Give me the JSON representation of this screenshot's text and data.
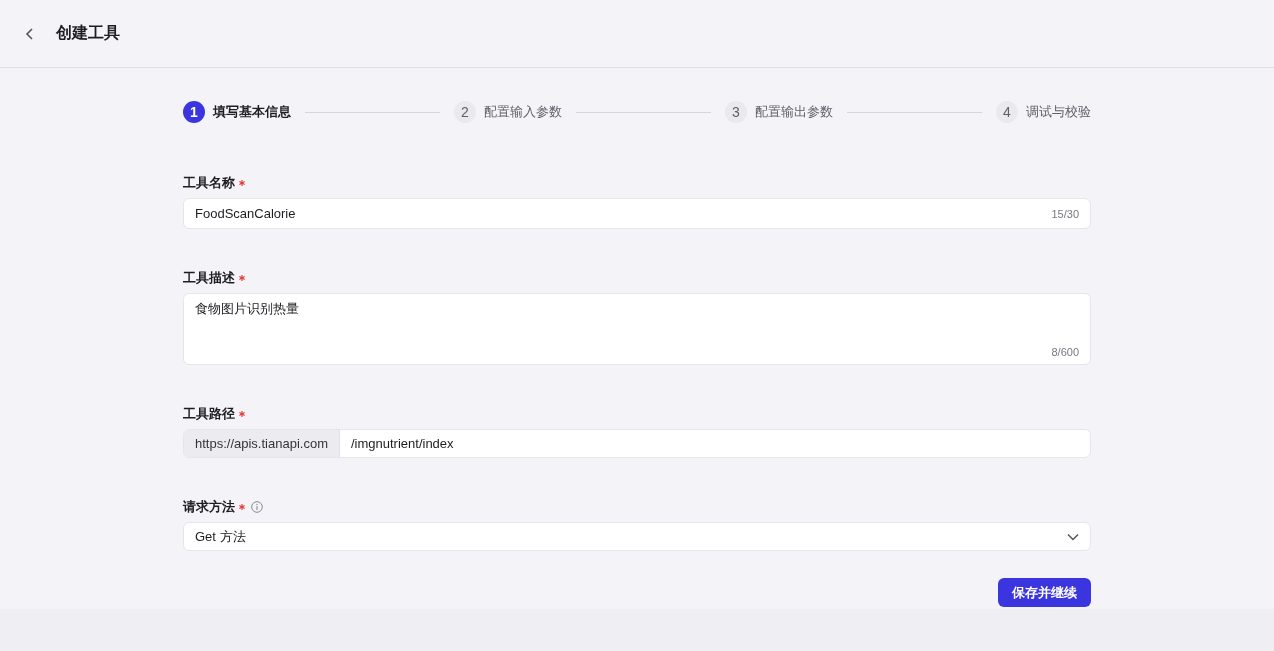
{
  "header": {
    "title": "创建工具"
  },
  "steps": [
    {
      "number": "1",
      "label": "填写基本信息",
      "selected": true
    },
    {
      "number": "2",
      "label": "配置输入参数",
      "selected": false
    },
    {
      "number": "3",
      "label": "配置输出参数",
      "selected": false
    },
    {
      "number": "4",
      "label": "调试与校验",
      "selected": false
    }
  ],
  "fields": [
    {
      "kind": "text",
      "label": "工具名称",
      "required": true,
      "value": "FoodScanCalorie",
      "counter": "15/30"
    },
    {
      "kind": "textarea",
      "label": "工具描述",
      "required": true,
      "value": "食物图片识别热量",
      "counter": "8/600"
    },
    {
      "kind": "url",
      "label": "工具路径",
      "required": true,
      "prefix": "https://apis.tianapi.com",
      "value": "/imgnutrient/index"
    },
    {
      "kind": "select",
      "label": "请求方法",
      "required": true,
      "info": true,
      "value": "Get 方法"
    }
  ],
  "submit_button": "保存并继续"
}
